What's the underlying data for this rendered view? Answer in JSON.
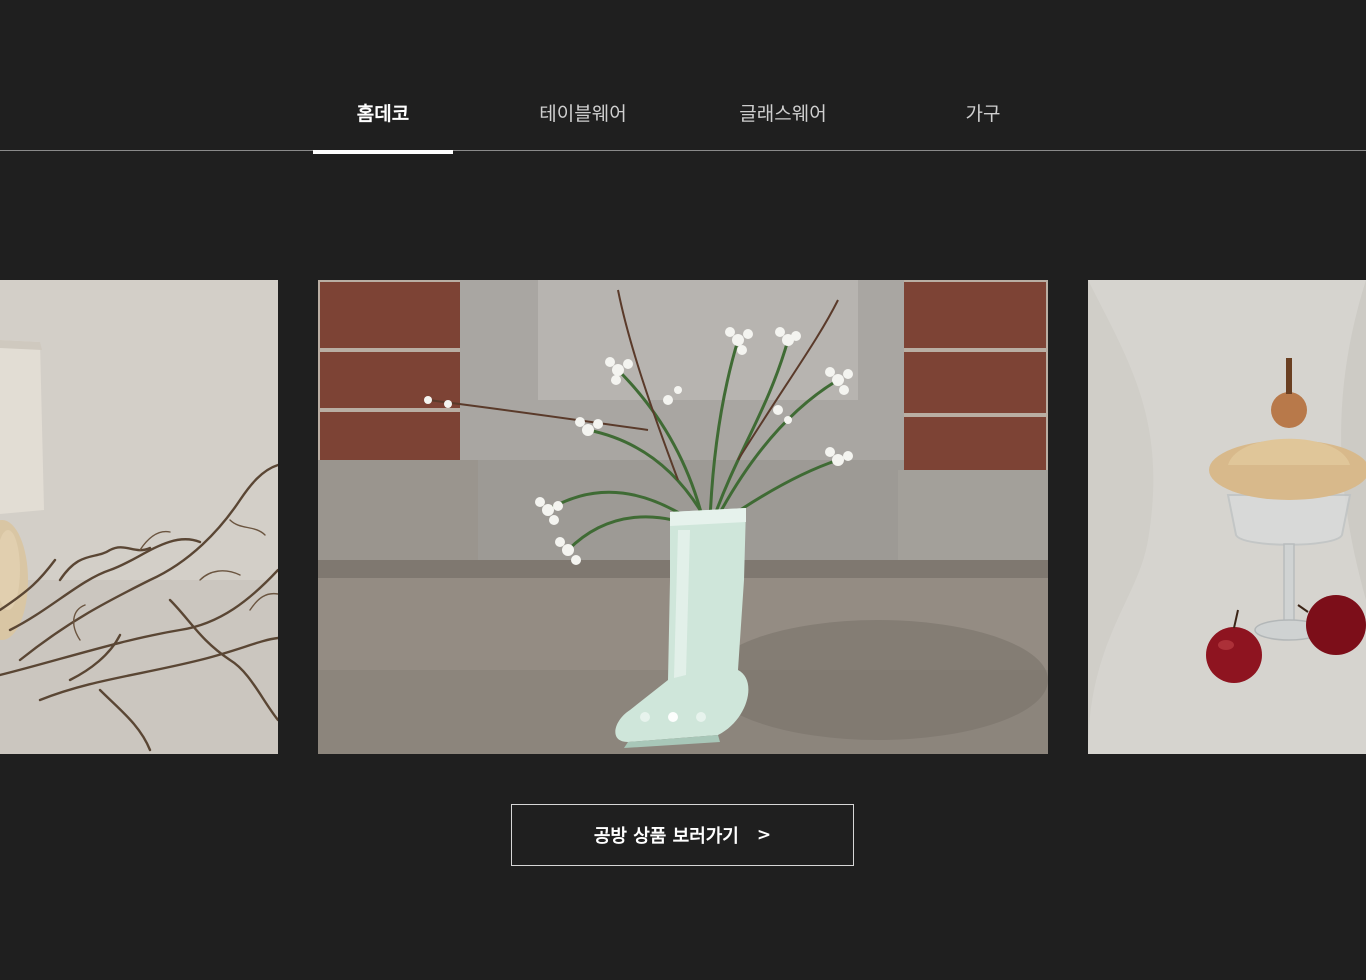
{
  "tabs": [
    {
      "label": "홈데코",
      "active": true
    },
    {
      "label": "테이블웨어",
      "active": false
    },
    {
      "label": "글래스웨어",
      "active": false
    },
    {
      "label": "가구",
      "active": false
    }
  ],
  "carousel": {
    "slide_count": 3,
    "active_dot": 2,
    "slides": [
      {
        "subject": "lamp-and-dried-branches"
      },
      {
        "subject": "ceramic-boot-vase-with-flowers"
      },
      {
        "subject": "wooden-lidded-glass-and-apples"
      }
    ]
  },
  "cta": {
    "label": "공방 상품 보러가기",
    "chevron": ">"
  },
  "colors": {
    "background": "#1f1f1f",
    "text": "#ffffff",
    "tab_inactive": "#cfcfcf",
    "divider": "#8a8a8a"
  }
}
